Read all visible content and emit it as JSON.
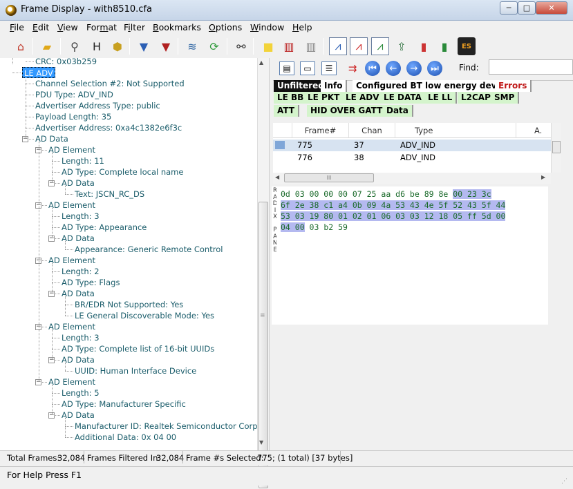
{
  "window": {
    "title": "Frame Display - with8510.cfa",
    "min": "─",
    "max": "□",
    "close": "✕"
  },
  "menu": [
    "File",
    "Edit",
    "View",
    "Format",
    "Filter",
    "Bookmarks",
    "Options",
    "Window",
    "Help"
  ],
  "menu_underlines": [
    "F",
    "E",
    "V",
    "m",
    "i",
    "B",
    "O",
    "W",
    "H"
  ],
  "toolbar_icons": [
    "home-icon",
    "open-folder-icon",
    "magnifier-icon",
    "hex-columns-icon",
    "database-icon",
    "filter-icon",
    "filter-down-icon",
    "layers-icon",
    "refresh-icon",
    "binoculars-icon",
    "note-icon",
    "book-open-red-icon",
    "book-open-icon",
    "chart-blue-icon",
    "chart-red-icon",
    "chart-green-icon",
    "export-icon",
    "bar-chart-icon",
    "bar-chart-multi-icon",
    "es-icon"
  ],
  "tree": [
    {
      "text": "CRC: 0x03b259",
      "level": 1
    },
    {
      "text": "LE ADV",
      "level": 0,
      "selected": true
    },
    {
      "text": "Channel Selection #2: Not Supported",
      "level": 1
    },
    {
      "text": "PDU Type: ADV_IND",
      "level": 1
    },
    {
      "text": "Advertiser Address Type: public",
      "level": 1
    },
    {
      "text": "Payload Length: 35",
      "level": 1
    },
    {
      "text": "Advertiser Address: 0xa4c1382e6f3c",
      "level": 1
    },
    {
      "text": "AD Data",
      "level": 1,
      "exp": "-"
    },
    {
      "text": "AD Element",
      "level": 2,
      "exp": "-"
    },
    {
      "text": "Length: 11",
      "level": 3
    },
    {
      "text": "AD Type: Complete local name",
      "level": 3
    },
    {
      "text": "AD Data",
      "level": 3,
      "exp": "-"
    },
    {
      "text": "Text: JSCN_RC_DS",
      "level": 4
    },
    {
      "text": "AD Element",
      "level": 2,
      "exp": "-"
    },
    {
      "text": "Length: 3",
      "level": 3
    },
    {
      "text": "AD Type: Appearance",
      "level": 3
    },
    {
      "text": "AD Data",
      "level": 3,
      "exp": "-"
    },
    {
      "text": "Appearance: Generic Remote Control",
      "level": 4
    },
    {
      "text": "AD Element",
      "level": 2,
      "exp": "-"
    },
    {
      "text": "Length: 2",
      "level": 3
    },
    {
      "text": "AD Type: Flags",
      "level": 3
    },
    {
      "text": "AD Data",
      "level": 3,
      "exp": "-"
    },
    {
      "text": "BR/EDR Not Supported: Yes",
      "level": 4
    },
    {
      "text": "LE General Discoverable Mode: Yes",
      "level": 4
    },
    {
      "text": "AD Element",
      "level": 2,
      "exp": "-"
    },
    {
      "text": "Length: 3",
      "level": 3
    },
    {
      "text": "AD Type: Complete list of 16-bit UUIDs",
      "level": 3
    },
    {
      "text": "AD Data",
      "level": 3,
      "exp": "-"
    },
    {
      "text": "UUID: Human Interface Device",
      "level": 4
    },
    {
      "text": "AD Element",
      "level": 2,
      "exp": "-"
    },
    {
      "text": "Length: 5",
      "level": 3
    },
    {
      "text": "AD Type: Manufacturer Specific",
      "level": 3
    },
    {
      "text": "AD Data",
      "level": 3,
      "exp": "-"
    },
    {
      "text": "Manufacturer ID: Realtek Semiconductor Corporation",
      "level": 4
    },
    {
      "text": "Additional Data: 0x 04 00",
      "level": 4
    }
  ],
  "find_label": "Find:",
  "nav_icons": [
    "pane-layout-1-icon",
    "pane-layout-2-icon",
    "pane-layout-3-icon",
    "jump-icon",
    "first-frame-icon",
    "prev-frame-icon",
    "next-frame-icon",
    "last-frame-icon"
  ],
  "tabs_row1": [
    {
      "label": "Unfiltered",
      "active": true
    },
    {
      "label": "Info"
    },
    {
      "label": "Configured BT low energy devices"
    },
    {
      "label": "Errors",
      "red": true
    }
  ],
  "tabs_row2": [
    "LE BB",
    "LE PKT",
    "LE ADV",
    "LE DATA",
    "LE LL",
    "L2CAP",
    "SMP"
  ],
  "tabs_row3": [
    "ATT",
    "HID OVER GATT",
    "Data"
  ],
  "columns": [
    "Frame#",
    "Chan",
    "Type",
    "A."
  ],
  "rows": [
    {
      "frame": "775",
      "chan": "37",
      "type": "ADV_IND",
      "selected": true
    },
    {
      "frame": "776",
      "chan": "38",
      "type": "ADV_IND"
    }
  ],
  "scroll_thumb_glyph": "III",
  "radix_label": [
    "R",
    "A",
    "D",
    "I",
    "X",
    "",
    "P",
    "A",
    "N",
    "E"
  ],
  "hex": [
    {
      "plain": "0d 03 00 00 00 07 25 aa d6 be 89 8e ",
      "hl": "00 23 3c"
    },
    {
      "plain": "",
      "hl": "6f 2e 38 c1 a4 0b 09 4a 53 43 4e 5f 52 43 5f 44"
    },
    {
      "plain": "",
      "hl": "53 03 19 80 01 02 01 06 03 03 12 18 05 ff 5d 00"
    },
    {
      "plain_after": " 03 b2 59",
      "hl": "04 00"
    }
  ],
  "status": {
    "total_label": "Total Frames:",
    "total": "32,084",
    "filtered_label": "Frames Filtered In:",
    "filtered": "32,084",
    "selected_label": "Frame #s Selected:",
    "selected": "775; (1 total) [37 bytes]"
  },
  "help": "For Help Press F1"
}
